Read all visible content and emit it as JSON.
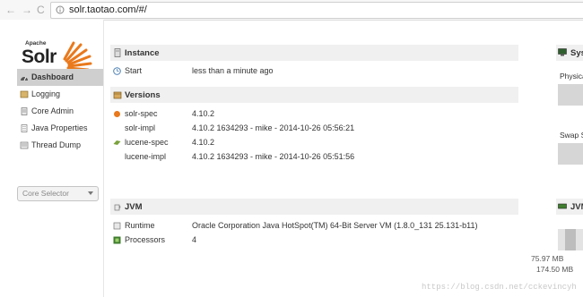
{
  "browser": {
    "url": "solr.taotao.com/#/",
    "back_glyph": "←",
    "forward_glyph": "→",
    "reload_glyph": "C"
  },
  "logo": {
    "apache": "Apache",
    "solr": "Solr"
  },
  "sidebar": {
    "items": [
      {
        "label": "Dashboard",
        "icon": "dashboard-icon",
        "active": true
      },
      {
        "label": "Logging",
        "icon": "logging-icon"
      },
      {
        "label": "Core Admin",
        "icon": "core-admin-icon"
      },
      {
        "label": "Java Properties",
        "icon": "java-properties-icon"
      },
      {
        "label": "Thread Dump",
        "icon": "thread-dump-icon"
      }
    ],
    "core_selector": "Core Selector"
  },
  "instance": {
    "title": "Instance",
    "start_label": "Start",
    "start_value": "less than a minute ago"
  },
  "versions": {
    "title": "Versions",
    "rows": [
      {
        "key": "solr-spec",
        "value": "4.10.2"
      },
      {
        "key": "solr-impl",
        "value": "4.10.2 1634293 - mike - 2014-10-26 05:56:21"
      },
      {
        "key": "lucene-spec",
        "value": "4.10.2"
      },
      {
        "key": "lucene-impl",
        "value": "4.10.2 1634293 - mike - 2014-10-26 05:51:56"
      }
    ]
  },
  "jvm": {
    "title": "JVM",
    "runtime_label": "Runtime",
    "runtime_value": "Oracle Corporation Java HotSpot(TM) 64-Bit Server VM (1.8.0_131 25.131-b11)",
    "processors_label": "Processors",
    "processors_value": "4"
  },
  "system": {
    "title": "Sys",
    "physical_label": "Physica",
    "swap_label": "Swap S"
  },
  "jvm_memory": {
    "title": "JVM",
    "used": "75.97 MB",
    "total": "174.50 MB"
  },
  "watermark": "https://blog.csdn.net/cckevincyh",
  "colors": {
    "accent": "#e9791c",
    "active_menu": "#cfcfcf",
    "panel_header": "#f0f0f0"
  }
}
